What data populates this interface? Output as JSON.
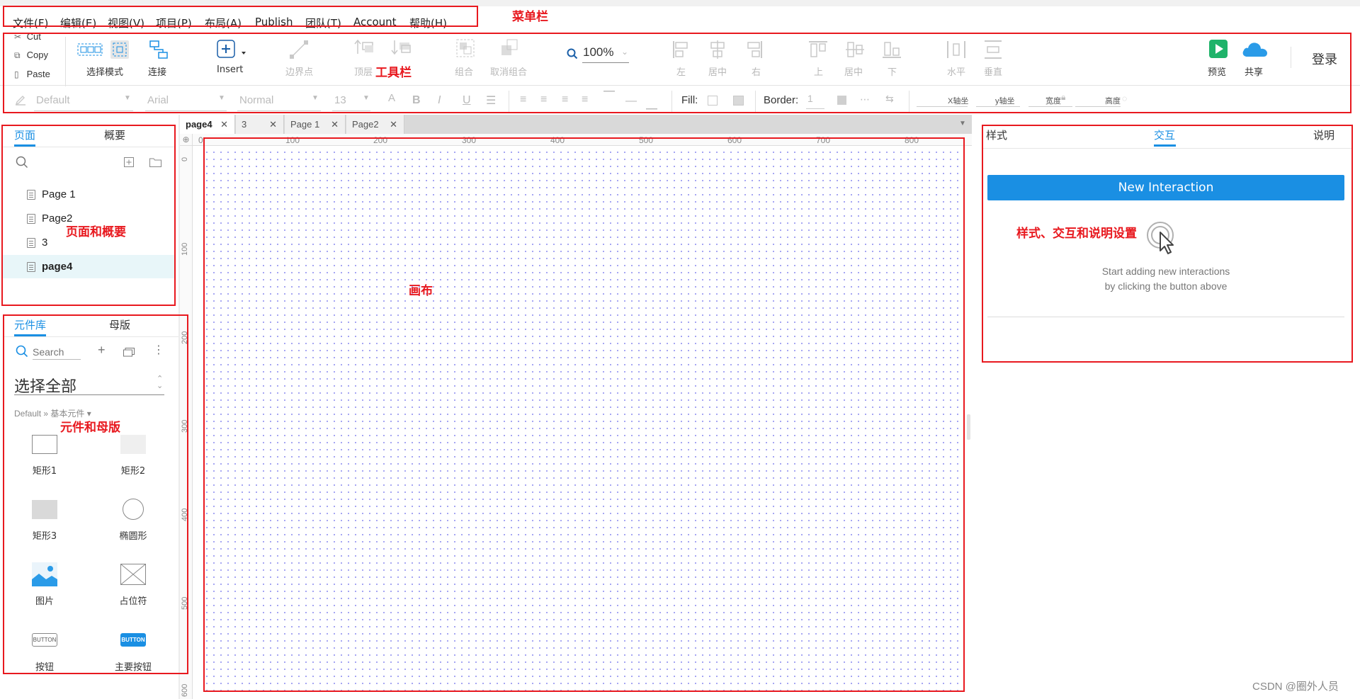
{
  "menubar": {
    "items": [
      "文件(F)",
      "编辑(E)",
      "视图(V)",
      "项目(P)",
      "布局(A)",
      "Publish",
      "团队(T)",
      "Account",
      "帮助(H)"
    ]
  },
  "annotations": {
    "menubar": "菜单栏",
    "toolbar": "工具栏",
    "pages": "页面和概要",
    "library": "元件和母版",
    "canvas": "画布",
    "right": "样式、交互和说明设置"
  },
  "toolbar": {
    "clipboard": [
      "Cut",
      "Copy",
      "Paste"
    ],
    "select_mode": "选择模式",
    "connect": "连接",
    "insert": "Insert",
    "boundary": "边界点",
    "top_layer": "顶层",
    "bottom_layer": "底层",
    "group": "组合",
    "ungroup": "取消组合",
    "zoom": "100%",
    "align_left": "左",
    "align_center": "居中",
    "align_right": "右",
    "align_top": "上",
    "align_middle": "居中",
    "align_bottom": "下",
    "distribute_h": "水平",
    "distribute_v": "垂直",
    "preview": "预览",
    "share": "共享",
    "login": "登录",
    "format": {
      "style": "Default",
      "font": "Arial",
      "weight": "Normal",
      "size": "13",
      "fill_label": "Fill:",
      "border_label": "Border:",
      "border_value": "1",
      "x_label": "X轴坐",
      "y_label": "y轴坐",
      "w_label": "宽度",
      "h_label": "高度"
    }
  },
  "pages_panel": {
    "tabs": [
      "页面",
      "概要"
    ],
    "pages": [
      "Page 1",
      "Page2",
      "3",
      "page4"
    ],
    "selected": "page4"
  },
  "library_panel": {
    "tabs": [
      "元件库",
      "母版"
    ],
    "search_placeholder": "Search",
    "select_all": "选择全部",
    "breadcrumb": "Default » 基本元件 ▾",
    "widgets": [
      "矩形1",
      "矩形2",
      "矩形3",
      "椭圆形",
      "图片",
      "占位符",
      "按钮",
      "主要按钮"
    ],
    "button_caption": "BUTTON"
  },
  "canvas": {
    "tabs": [
      "page4",
      "3",
      "Page 1",
      "Page2"
    ],
    "ruler_h": [
      "0",
      "100",
      "200",
      "300",
      "400",
      "500",
      "600",
      "700",
      "800"
    ],
    "ruler_v": [
      "0",
      "100",
      "200",
      "300",
      "400",
      "500",
      "600"
    ]
  },
  "right_panel": {
    "tabs": [
      "样式",
      "交互",
      "说明"
    ],
    "active_tab": "交互",
    "new_interaction": "New Interaction",
    "hint_line1": "Start adding new interactions",
    "hint_line2": "by clicking the button above"
  },
  "watermark": "CSDN @圈外人员",
  "colors": {
    "accent": "#1a8fe3",
    "annotation": "#e8191f",
    "preview_green": "#1fb36a",
    "grid_dot": "#8f8ff0"
  }
}
